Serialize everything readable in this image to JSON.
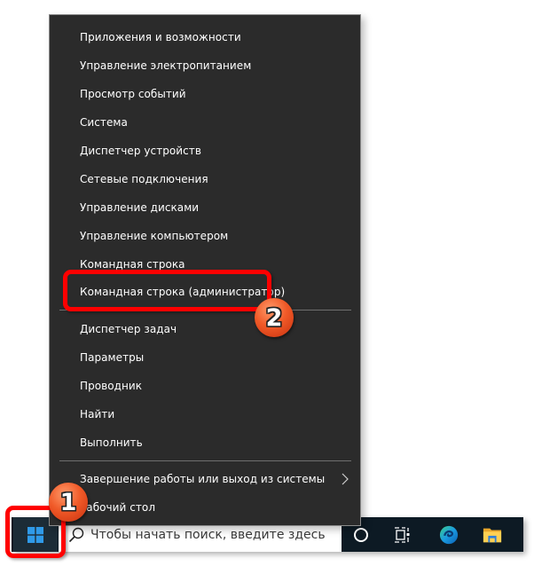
{
  "context_menu": {
    "groups": [
      [
        {
          "label": "Приложения и возможности"
        },
        {
          "label": "Управление электропитанием"
        },
        {
          "label": "Просмотр событий"
        },
        {
          "label": "Система"
        },
        {
          "label": "Диспетчер устройств"
        },
        {
          "label": "Сетевые подключения"
        },
        {
          "label": "Управление дисками"
        },
        {
          "label": "Управление компьютером"
        },
        {
          "label": "Командная строка"
        },
        {
          "label": "Командная строка (администратор)",
          "highlighted": true
        }
      ],
      [
        {
          "label": "Диспетчер задач"
        },
        {
          "label": "Параметры"
        },
        {
          "label": "Проводник"
        },
        {
          "label": "Найти"
        },
        {
          "label": "Выполнить"
        }
      ],
      [
        {
          "label": "Завершение работы или выход из системы",
          "submenu": true
        },
        {
          "label": "Рабочий стол"
        }
      ]
    ]
  },
  "taskbar": {
    "start_icon": "windows-logo-icon",
    "search_placeholder": "Чтобы начать поиск, введите здесь",
    "icons": [
      "cortana-circle-icon",
      "task-view-icon",
      "edge-browser-icon",
      "file-explorer-icon"
    ]
  },
  "annotations": {
    "badge_1": "1",
    "badge_2": "2",
    "highlight_color": "#ff0000",
    "badge_color": "#f05a28"
  }
}
